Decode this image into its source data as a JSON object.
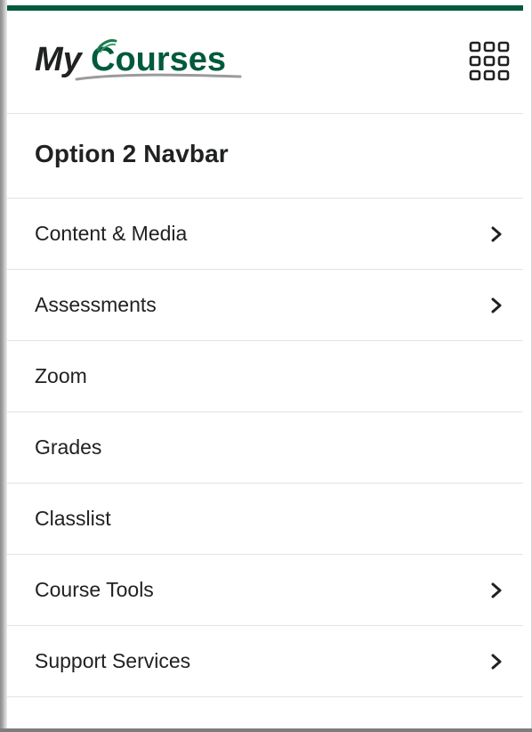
{
  "colors": {
    "brand_green": "#005a3c",
    "text": "#202122",
    "divider": "#e3e3e3"
  },
  "logo": {
    "text_my": "My",
    "text_courses": "Courses",
    "icon": "mycourses-logo"
  },
  "apps_button": {
    "icon": "waffle-grid-icon"
  },
  "course": {
    "title": "Option 2 Navbar"
  },
  "nav": {
    "items": [
      {
        "label": "Content & Media",
        "has_submenu": true
      },
      {
        "label": "Assessments",
        "has_submenu": true
      },
      {
        "label": "Zoom",
        "has_submenu": false
      },
      {
        "label": "Grades",
        "has_submenu": false
      },
      {
        "label": "Classlist",
        "has_submenu": false
      },
      {
        "label": "Course Tools",
        "has_submenu": true
      },
      {
        "label": "Support Services",
        "has_submenu": true
      }
    ]
  }
}
